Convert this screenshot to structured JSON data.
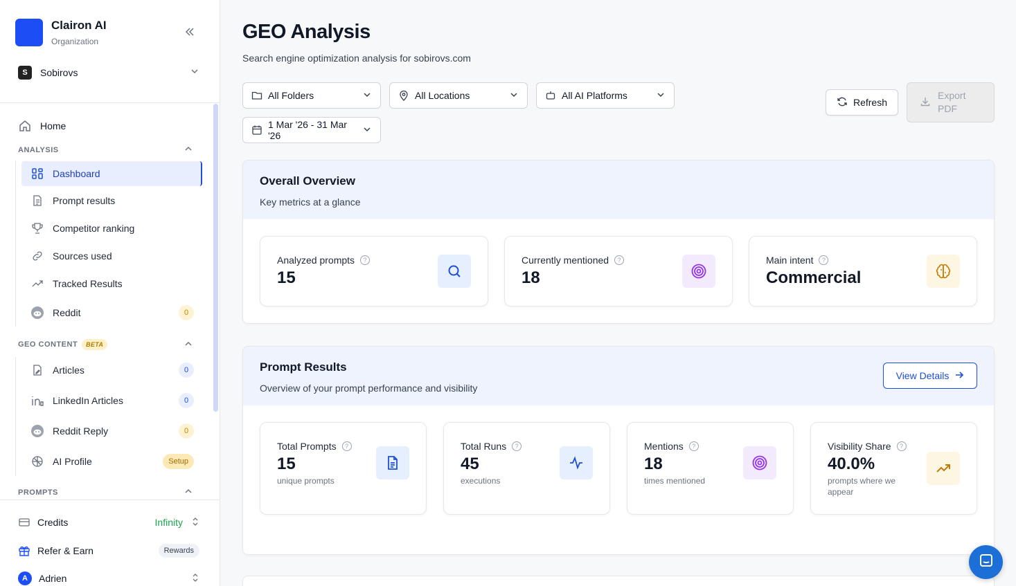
{
  "org": {
    "name": "Clairon AI",
    "subtitle": "Organization"
  },
  "workspace": {
    "initial": "S",
    "name": "Sobirovs"
  },
  "nav": {
    "home": "Home",
    "analysis_header": "ANALYSIS",
    "analysis_items": [
      {
        "label": "Dashboard",
        "icon": "grid-icon"
      },
      {
        "label": "Prompt results",
        "icon": "document-icon"
      },
      {
        "label": "Competitor ranking",
        "icon": "trophy-icon"
      },
      {
        "label": "Sources used",
        "icon": "link-icon"
      },
      {
        "label": "Tracked Results",
        "icon": "trend-icon"
      },
      {
        "label": "Reddit",
        "icon": "reddit-icon",
        "badge": "0"
      }
    ],
    "geo_header": "GEO CONTENT",
    "geo_beta": "BETA",
    "geo_items": [
      {
        "label": "Articles",
        "icon": "article-icon",
        "badge": "0"
      },
      {
        "label": "LinkedIn Articles",
        "icon": "linkedin-icon",
        "badge": "0"
      },
      {
        "label": "Reddit Reply",
        "icon": "reddit-icon",
        "badge": "0"
      },
      {
        "label": "AI Profile",
        "icon": "brain-icon",
        "badge": "Setup"
      }
    ],
    "prompts_header": "PROMPTS"
  },
  "bottom": {
    "credits_label": "Credits",
    "credits_value": "Infinity",
    "refer_label": "Refer & Earn",
    "refer_badge": "Rewards",
    "user_initial": "A",
    "user_name": "Adrien"
  },
  "header": {
    "title": "GEO Analysis",
    "subtitle": "Search engine optimization analysis for sobirovs.com"
  },
  "filters": {
    "folders": "All Folders",
    "locations": "All Locations",
    "platforms": "All AI Platforms",
    "date_range": "1 Mar '26 - 31 Mar '26",
    "refresh": "Refresh",
    "export": "Export PDF"
  },
  "overview": {
    "title": "Overall Overview",
    "subtitle": "Key metrics at a glance",
    "metrics": [
      {
        "label": "Analyzed prompts",
        "value": "15",
        "icon": "search-icon"
      },
      {
        "label": "Currently mentioned",
        "value": "18",
        "icon": "target-icon"
      },
      {
        "label": "Main intent",
        "value": "Commercial",
        "icon": "brain-icon"
      }
    ]
  },
  "prompt_results": {
    "title": "Prompt Results",
    "subtitle": "Overview of your prompt performance and visibility",
    "view_details": "View Details",
    "metrics": [
      {
        "label": "Total Prompts",
        "value": "15",
        "note": "unique prompts",
        "icon": "document-icon"
      },
      {
        "label": "Total Runs",
        "value": "45",
        "note": "executions",
        "icon": "activity-icon"
      },
      {
        "label": "Mentions",
        "value": "18",
        "note": "times mentioned",
        "icon": "target-icon"
      },
      {
        "label": "Visibility Share",
        "value": "40.0%",
        "note": "prompts where we appear",
        "icon": "trending-up-icon"
      }
    ]
  },
  "colors": {
    "accent": "#1d4ef5",
    "active_bg": "#e8eefe",
    "card_head": "#eef3fd",
    "success": "#16a34a"
  }
}
